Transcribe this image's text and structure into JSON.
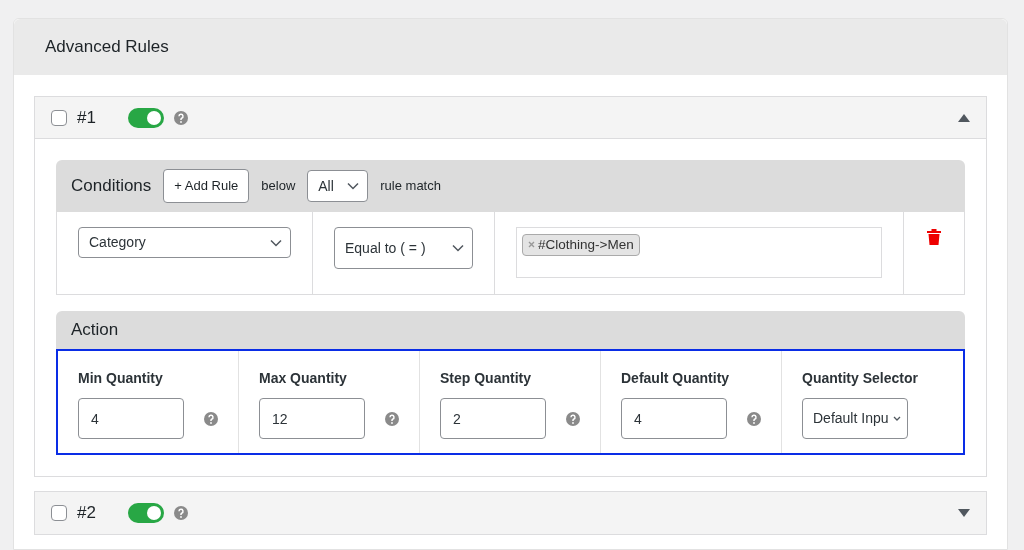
{
  "panel": {
    "title": "Advanced Rules"
  },
  "rules": [
    {
      "label": "#1",
      "checked": false,
      "enabled": true,
      "expanded": true,
      "conditions": {
        "title": "Conditions",
        "add_button": "+ Add Rule",
        "below": "below",
        "match": "All",
        "match_suffix": "rule match",
        "rows": [
          {
            "field": "Category",
            "operator": "Equal to ( = )",
            "tags": [
              "#Clothing->Men"
            ]
          }
        ]
      },
      "action": {
        "title": "Action",
        "fields": [
          {
            "label": "Min Quantity",
            "value": "4",
            "kind": "number"
          },
          {
            "label": "Max Quantity",
            "value": "12",
            "kind": "number"
          },
          {
            "label": "Step Quantity",
            "value": "2",
            "kind": "number"
          },
          {
            "label": "Default Quantity",
            "value": "4",
            "kind": "number"
          },
          {
            "label": "Quantity Selector",
            "value": "Default Inpu",
            "kind": "select"
          }
        ]
      }
    },
    {
      "label": "#2",
      "checked": false,
      "enabled": true,
      "expanded": false
    }
  ]
}
